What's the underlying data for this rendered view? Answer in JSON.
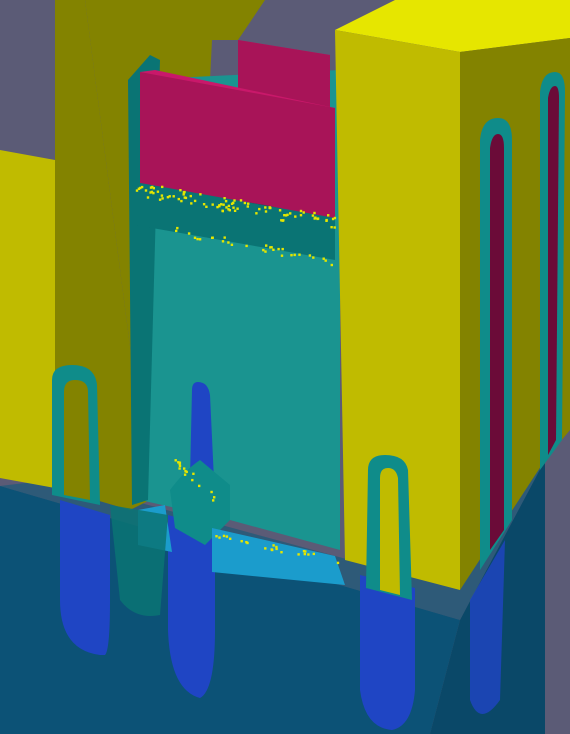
{
  "scene": {
    "kind": "3D semiconductor device cross-section rendering",
    "colors": {
      "background": "#5b5b76",
      "substrate_front": "#0c5276",
      "substrate_right": "#0a4868",
      "substrate_top": "#0a5a7a",
      "well_blue": "#1f45c4",
      "liner_teal": "#0f8c8a",
      "liner_teal_dark": "#0a7474",
      "cavity_teal": "#1a9490",
      "cavity_floor_cyan": "#1b9ccc",
      "oxide_yellow": "#c0bb00",
      "oxide_olive": "#838300",
      "oxide_top_bright": "#e6e600",
      "gate_magenta_top": "#c9186a",
      "gate_magenta_front": "#a81458",
      "gate_magenta_dark": "#6b0b38",
      "dopant_speckle": "#e5e600"
    },
    "materials": [
      "substrate",
      "deep-well",
      "liner",
      "oxide",
      "gate"
    ]
  }
}
